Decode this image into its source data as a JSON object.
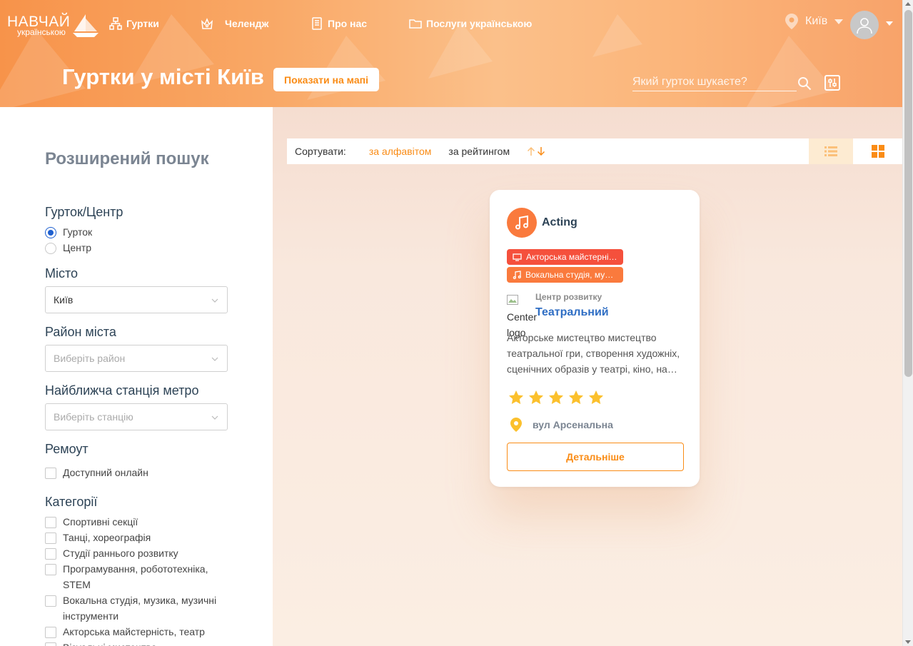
{
  "header": {
    "logo_main": "НАВЧАЙ",
    "logo_sub": "українською",
    "nav": [
      {
        "label": "Гуртки",
        "icon": "clubs-icon"
      },
      {
        "label": "Челендж",
        "icon": "crown-icon"
      },
      {
        "label": "Про нас",
        "icon": "document-icon"
      },
      {
        "label": "Послуги українською",
        "icon": "folder-icon"
      }
    ],
    "city": "Київ",
    "page_title": "Гуртки у місті Київ",
    "map_button": "Показати на мапі",
    "search_placeholder": "Який гурток шукаєте?"
  },
  "sidebar": {
    "title": "Розширений пошук",
    "type_label": "Гурток/Центр",
    "type_options": [
      {
        "label": "Гурток",
        "checked": true
      },
      {
        "label": "Центр",
        "checked": false
      }
    ],
    "city_label": "Місто",
    "city_value": "Київ",
    "district_label": "Район міста",
    "district_placeholder": "Виберіть район",
    "metro_label": "Найближча станція метро",
    "metro_placeholder": "Виберіть станцію",
    "remote_label": "Ремоут",
    "remote_option": "Доступний онлайн",
    "categories_label": "Категорії",
    "categories": [
      "Спортивні секції",
      "Танці, хореографія",
      "Студії раннього розвитку",
      "Програмування, робототехніка, STEM",
      "Вокальна студія, музика, музичні інструменти",
      "Акторська майстерність, театр",
      "Візуальні мистецтва"
    ]
  },
  "sort": {
    "label": "Сортувати:",
    "alphabet": "за алфавітом",
    "rating": "за рейтингом"
  },
  "card": {
    "title": "Acting",
    "tags": [
      {
        "label": "Акторська майстерність, театр",
        "color": "#f5503c"
      },
      {
        "label": "Вокальна студія, музика, музичні інструменти",
        "color": "#fa7a3d"
      }
    ],
    "center_logo_alt": "Center logo",
    "center_type": "Центр розвитку",
    "center_name": "Театральний",
    "description": "Акторське мистецтво мистецтво театральної гри, створення художніх, сценічних образів у театрі, кіно, на телебаченні та радіо.",
    "rating": 5,
    "address": "вул Арсенальна",
    "details_button": "Детальніше"
  },
  "colors": {
    "accent": "#fa8c16",
    "link": "#2f6ec4",
    "star": "#fbc02d"
  }
}
